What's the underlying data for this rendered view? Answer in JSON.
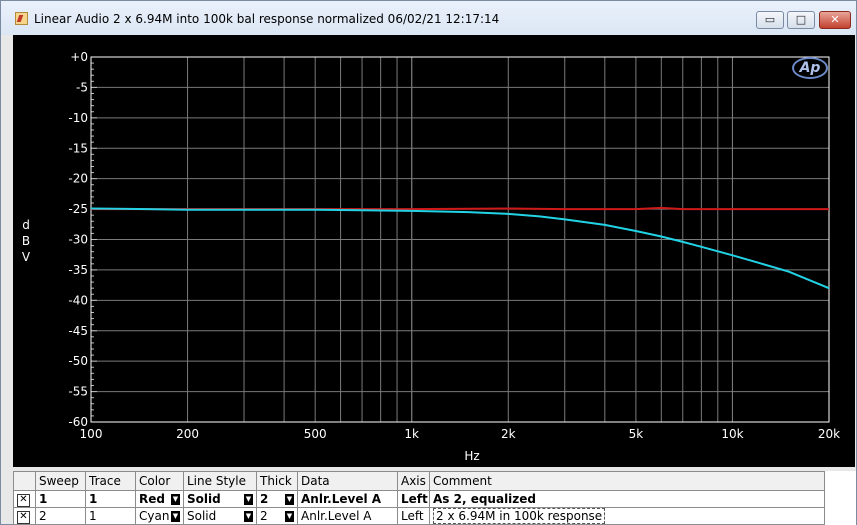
{
  "window": {
    "title": "Linear Audio  2 x 6.94M into 100k bal response normalized  06/02/21 12:17:14",
    "buttons": {
      "minimize": "▭",
      "maximize": "□",
      "close": "✕"
    }
  },
  "logo": "Ap",
  "chart_data": {
    "type": "line",
    "xscale": "log",
    "xlim": [
      100,
      20000
    ],
    "ylim": [
      -60,
      0
    ],
    "xlabel": "Hz",
    "ylabel": "d\nB\nV",
    "y_ticks": [
      0,
      -5,
      -10,
      -15,
      -20,
      -25,
      -30,
      -35,
      -40,
      -45,
      -50,
      -55,
      -60
    ],
    "y_tick_labels": [
      "+0",
      "-5",
      "-10",
      "-15",
      "-20",
      "-25",
      "-30",
      "-35",
      "-40",
      "-45",
      "-50",
      "-55",
      "-60"
    ],
    "x_ticks": [
      100,
      200,
      500,
      1000,
      2000,
      5000,
      10000,
      20000
    ],
    "x_tick_labels": [
      "100",
      "200",
      "500",
      "1k",
      "2k",
      "5k",
      "10k",
      "20k"
    ],
    "grid": true,
    "series": [
      {
        "color": "#d01a1a",
        "x": [
          100,
          200,
          500,
          1000,
          2000,
          3000,
          5000,
          6000,
          7000,
          10000,
          15000,
          20000
        ],
        "y": [
          -25,
          -25,
          -25,
          -25,
          -24.9,
          -25,
          -25,
          -24.8,
          -25,
          -25,
          -25,
          -25
        ]
      },
      {
        "color": "#22d3e6",
        "x": [
          100,
          150,
          200,
          300,
          500,
          700,
          1000,
          1500,
          2000,
          2500,
          3000,
          4000,
          5000,
          6000,
          7000,
          8000,
          10000,
          12000,
          15000,
          20000
        ],
        "y": [
          -24.9,
          -25,
          -25.1,
          -25.1,
          -25.1,
          -25.2,
          -25.3,
          -25.5,
          -25.8,
          -26.2,
          -26.7,
          -27.6,
          -28.6,
          -29.5,
          -30.4,
          -31.2,
          -32.6,
          -33.8,
          -35.3,
          -38.0
        ]
      }
    ]
  },
  "legend": {
    "headers": [
      "Sweep",
      "Trace",
      "Color",
      "Line Style",
      "Thick",
      "Data",
      "Axis",
      "Comment"
    ],
    "rows": [
      {
        "check": "✕",
        "sweep": "1",
        "trace": "1",
        "color": "Red",
        "style": "Solid",
        "thick": "2",
        "data": "Anlr.Level A",
        "axis": "Left",
        "comment": "As 2, equalized"
      },
      {
        "check": "✕",
        "sweep": "2",
        "trace": "1",
        "color": "Cyan",
        "style": "Solid",
        "thick": "2",
        "data": "Anlr.Level A",
        "axis": "Left",
        "comment": "2 x 6.94M in 100k response"
      }
    ]
  }
}
